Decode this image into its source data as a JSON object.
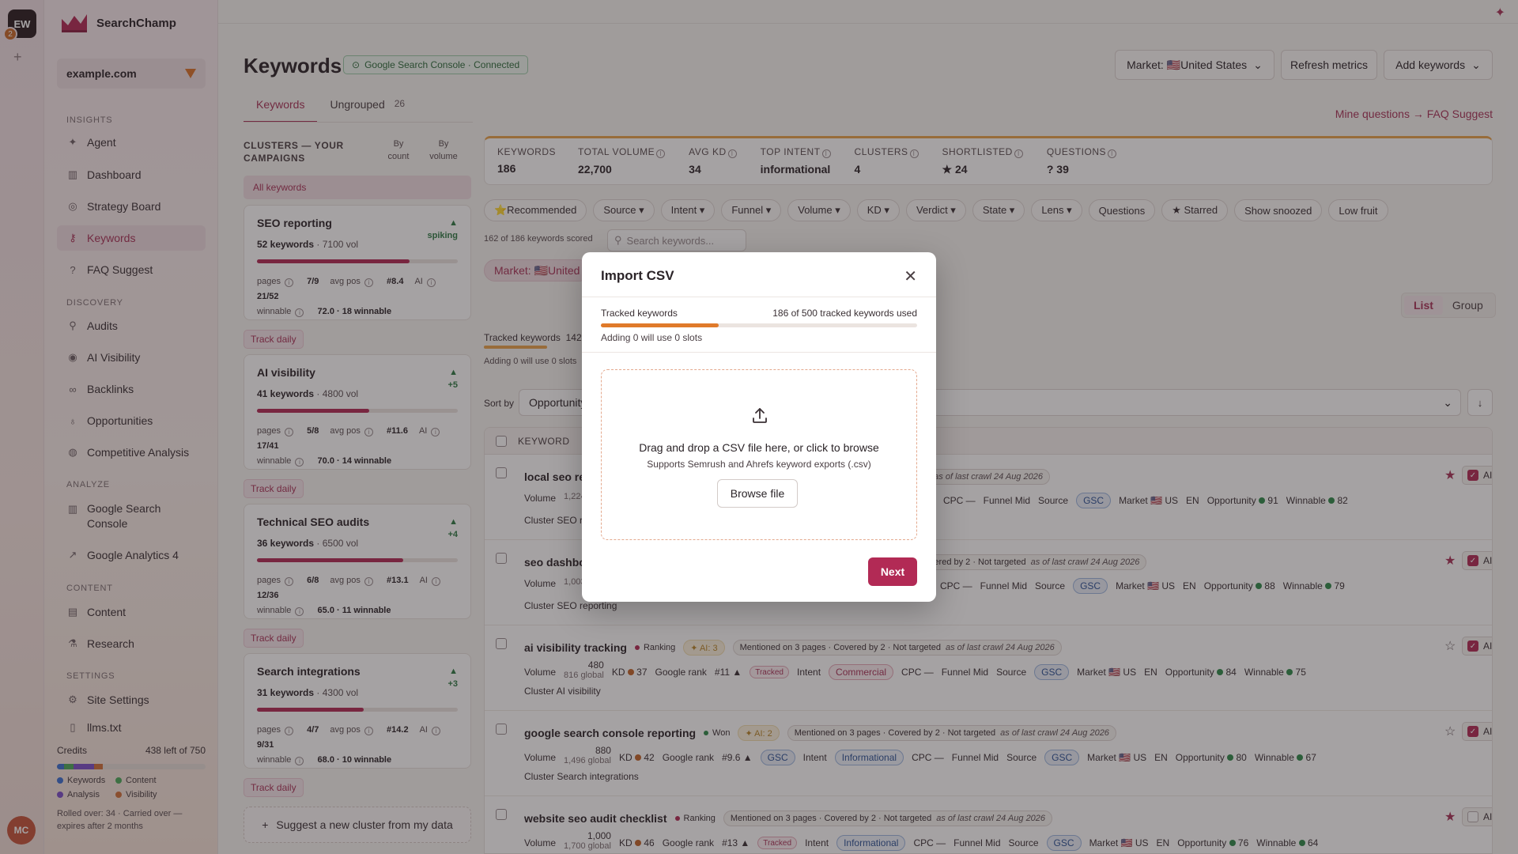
{
  "rail": {
    "workspace_initials": "EW",
    "workspace_badge": "2",
    "add_label": "+",
    "user_initials": "MC"
  },
  "sidebar": {
    "brand": "SearchChamp",
    "site": "example.com",
    "sections": {
      "insights": "Insights",
      "discovery": "Discovery",
      "analyze": "Analyze",
      "content": "Content",
      "settings": "Settings"
    },
    "items": {
      "agent": "Agent",
      "dashboard": "Dashboard",
      "strategy": "Strategy Board",
      "keywords": "Keywords",
      "faq": "FAQ Suggest",
      "audits": "Audits",
      "ai_visibility": "AI Visibility",
      "backlinks": "Backlinks",
      "opportunities": "Opportunities",
      "competitive": "Competitive Analysis",
      "gsc": "Google Search Console",
      "ga4": "Google Analytics 4",
      "content": "Content",
      "research": "Research",
      "site_settings": "Site Settings",
      "llms": "llms.txt"
    },
    "credits": {
      "label": "Credits",
      "remaining": "438 left of 750",
      "legend": [
        "Keywords",
        "Content",
        "Analysis",
        "Visibility"
      ],
      "segments": [
        {
          "color": "#3b6fd1",
          "share": 0.05
        },
        {
          "color": "#4caa5a",
          "share": 0.06
        },
        {
          "color": "#7a4fc9",
          "share": 0.14
        },
        {
          "color": "#d0713a",
          "share": 0.06
        }
      ],
      "note": "Rolled over: 34 · Carried over — expires after 2 months"
    }
  },
  "header": {
    "title": "Keywords",
    "gsc_status": "Google Search Console · Connected",
    "market_btn": "Market: 🇺🇸United States",
    "refresh_btn": "Refresh metrics",
    "add_btn": "Add keywords",
    "tabs": [
      {
        "label": "Keywords"
      },
      {
        "label": "Ungrouped",
        "count": "26"
      }
    ],
    "faq_link": "Mine questions → FAQ Suggest"
  },
  "clusters": {
    "title": "Clusters — your campaigns",
    "sort_count": "By count",
    "sort_volume": "By volume",
    "all": "All keywords",
    "track_label": "Track daily",
    "suggest": "Suggest a new cluster from my data",
    "items": [
      {
        "name": "SEO reporting",
        "trend": "spiking",
        "keywords": "52 keywords",
        "vol": "7100 vol",
        "fill": 0.76,
        "pages": "7/9",
        "avgpos": "#8.4",
        "ai": "21/52",
        "winnable": "72.0 · 18 winnable"
      },
      {
        "name": "AI visibility",
        "trend": "+5",
        "keywords": "41 keywords",
        "vol": "4800 vol",
        "fill": 0.56,
        "pages": "5/8",
        "avgpos": "#11.6",
        "ai": "17/41",
        "winnable": "70.0 · 14 winnable"
      },
      {
        "name": "Technical SEO audits",
        "trend": "+4",
        "keywords": "36 keywords",
        "vol": "6500 vol",
        "fill": 0.73,
        "pages": "6/8",
        "avgpos": "#13.1",
        "ai": "12/36",
        "winnable": "65.0 · 11 winnable"
      },
      {
        "name": "Search integrations",
        "trend": "+3",
        "keywords": "31 keywords",
        "vol": "4300 vol",
        "fill": 0.53,
        "pages": "4/7",
        "avgpos": "#14.2",
        "ai": "9/31",
        "winnable": "68.0 · 10 winnable"
      }
    ]
  },
  "stats": [
    {
      "label": "Keywords",
      "value": "186"
    },
    {
      "label": "Total volume",
      "value": "22,700"
    },
    {
      "label": "Avg KD",
      "value": "34"
    },
    {
      "label": "Top intent",
      "value": "informational"
    },
    {
      "label": "Clusters",
      "value": "4"
    },
    {
      "label": "Shortlisted",
      "value": "★ 24"
    },
    {
      "label": "Questions",
      "value": "? 39"
    }
  ],
  "filters": [
    "⭐Recommended",
    "Source ▾",
    "Intent ▾",
    "Funnel ▾",
    "Volume ▾",
    "KD ▾",
    "Verdict ▾",
    "State ▾",
    "Lens ▾",
    "Questions",
    "★ Starred",
    "Show snoozed",
    "Low fruit"
  ],
  "list": {
    "scored": "162 of 186 keywords scored",
    "search_placeholder": "Search keywords...",
    "market_chip": "Market: 🇺🇸United",
    "view_list": "List",
    "view_group": "Group",
    "tracked_label": "Tracked keywords",
    "tracked_count": "142",
    "adding_note": "Adding 0 will use 0 slots",
    "sort_label": "Sort by",
    "sort_value": "Opportunity",
    "column_keyword": "Keyword"
  },
  "rows": [
    {
      "keyword": "local seo re",
      "status": "",
      "ai": "",
      "tags": [],
      "crawl": "d",
      "crawl_date": "as of last crawl 24 Aug 2026",
      "volume": "",
      "global": "1,224",
      "kd": "",
      "rank": "",
      "tracked": "",
      "intent": "",
      "intent_class": "",
      "cpc": "CPC —",
      "funnel": "Funnel Mid",
      "source": "Source",
      "gsc": "GSC",
      "market": "Market 🇺🇸 US",
      "lang": "EN",
      "opportunity": "Opportunity",
      "opp": "91",
      "winnable": "Winnable",
      "win": "82",
      "cluster": "Cluster SEO r",
      "starred": true,
      "ai_on": true
    },
    {
      "keyword": "seo dashbo",
      "status": "",
      "ai": "",
      "tags": [
        "overed by 2",
        "Not targeted"
      ],
      "crawl": "",
      "crawl_date": "as of last crawl 24 Aug 2026",
      "volume": "",
      "global": "1,003",
      "kd": "",
      "rank": "",
      "tracked": "",
      "intent": "",
      "intent_class": "",
      "cpc": "CPC —",
      "funnel": "Funnel Mid",
      "source": "Source",
      "gsc": "GSC",
      "market": "Market 🇺🇸 US",
      "lang": "EN",
      "opportunity": "Opportunity",
      "opp": "88",
      "winnable": "Winnable",
      "win": "79",
      "cluster": "Cluster SEO reporting",
      "starred": true,
      "ai_on": true
    },
    {
      "keyword": "ai visibility tracking",
      "status": "Ranking",
      "ai": "AI: 3",
      "tags": [
        "Mentioned on 3 pages",
        "Covered by 2",
        "Not targeted"
      ],
      "crawl": "",
      "crawl_date": "as of last crawl 24 Aug 2026",
      "volume": "480",
      "global": "816 global",
      "kd": "37",
      "rank": "#11",
      "tracked": "Tracked",
      "intent": "Commercial",
      "intent_class": "com",
      "cpc": "CPC —",
      "funnel": "Funnel Mid",
      "source": "Source",
      "gsc": "GSC",
      "market": "Market 🇺🇸 US",
      "lang": "EN",
      "opportunity": "Opportunity",
      "opp": "84",
      "winnable": "Winnable",
      "win": "75",
      "cluster": "Cluster AI visibility",
      "starred": false,
      "ai_on": true
    },
    {
      "keyword": "google search console reporting",
      "status": "Won",
      "ai": "AI: 2",
      "tags": [
        "Mentioned on 3 pages",
        "Covered by 2",
        "Not targeted"
      ],
      "crawl": "",
      "crawl_date": "as of last crawl 24 Aug 2026",
      "volume": "880",
      "global": "1,496 global",
      "kd": "42",
      "rank": "#9.6",
      "tracked": "GSC",
      "intent": "Informational",
      "intent_class": "inf",
      "cpc": "CPC —",
      "funnel": "Funnel Mid",
      "source": "Source",
      "gsc": "GSC",
      "market": "Market 🇺🇸 US",
      "lang": "EN",
      "opportunity": "Opportunity",
      "opp": "80",
      "winnable": "Winnable",
      "win": "67",
      "cluster": "Cluster Search integrations",
      "starred": false,
      "ai_on": true
    },
    {
      "keyword": "website seo audit checklist",
      "status": "Ranking",
      "ai": "",
      "tags": [
        "Mentioned on 3 pages",
        "Covered by 2",
        "Not targeted"
      ],
      "crawl": "",
      "crawl_date": "as of last crawl 24 Aug 2026",
      "volume": "1,000",
      "global": "1,700 global",
      "kd": "46",
      "rank": "#13",
      "tracked": "Tracked",
      "intent": "Informational",
      "intent_class": "inf",
      "cpc": "CPC —",
      "funnel": "Funnel Mid",
      "source": "Source",
      "gsc": "GSC",
      "market": "Market 🇺🇸 US",
      "lang": "EN",
      "opportunity": "Opportunity",
      "opp": "76",
      "winnable": "Winnable",
      "win": "64",
      "cluster": "",
      "starred": true,
      "ai_on": false
    }
  ],
  "modal": {
    "title": "Import CSV",
    "usage_label": "Tracked keywords",
    "usage_value": "186 of 500 tracked keywords used",
    "usage_fraction": 0.372,
    "usage_note": "Adding 0 will use 0 slots",
    "drop_main": "Drag and drop a CSV file here, or click to browse",
    "drop_sub": "Supports Semrush and Ahrefs keyword exports (.csv)",
    "browse": "Browse file",
    "next": "Next"
  },
  "meta_labels": {
    "volume": "Volume",
    "kd": "KD",
    "google_rank": "Google rank",
    "intent": "Intent",
    "pages": "pages",
    "avg_pos": "avg pos",
    "ai": "AI",
    "winnable": "winnable"
  },
  "colors": {
    "accent": "#b22a55",
    "accent_text": "#a83358",
    "warning": "#e07a2a",
    "success": "#2f8a4a"
  }
}
